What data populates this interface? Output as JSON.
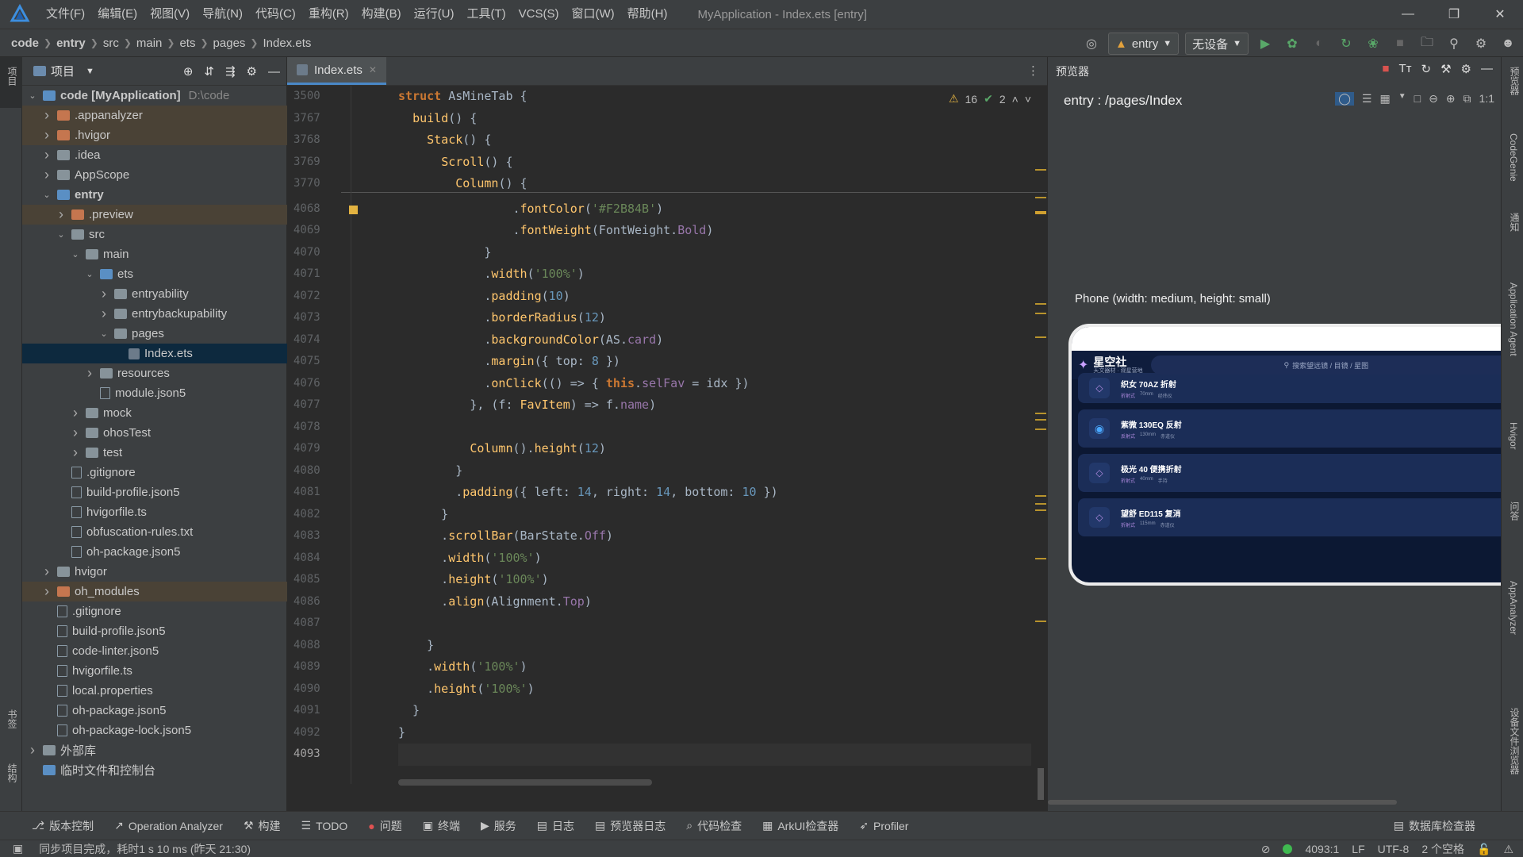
{
  "titlebar": {
    "menus": [
      "文件(F)",
      "编辑(E)",
      "视图(V)",
      "导航(N)",
      "代码(C)",
      "重构(R)",
      "构建(B)",
      "运行(U)",
      "工具(T)",
      "VCS(S)",
      "窗口(W)",
      "帮助(H)"
    ],
    "title": "MyApplication - Index.ets [entry]"
  },
  "navbar": {
    "breadcrumbs": [
      "code",
      "entry",
      "src",
      "main",
      "ets",
      "pages",
      "Index.ets"
    ],
    "run_config": "entry",
    "device": "无设备"
  },
  "project": {
    "title": "项目",
    "tree": [
      {
        "label": "code [MyApplication]",
        "extra": "D:\\code",
        "depth": 0,
        "arrow": "down",
        "kind": "dir-b",
        "bold": true
      },
      {
        "label": ".appanalyzer",
        "depth": 1,
        "arrow": "right",
        "kind": "dir-o",
        "hl": true
      },
      {
        "label": ".hvigor",
        "depth": 1,
        "arrow": "right",
        "kind": "dir-o",
        "hl": true
      },
      {
        "label": ".idea",
        "depth": 1,
        "arrow": "right",
        "kind": "dir"
      },
      {
        "label": "AppScope",
        "depth": 1,
        "arrow": "right",
        "kind": "dir"
      },
      {
        "label": "entry",
        "depth": 1,
        "arrow": "down",
        "kind": "dir-b",
        "bold": true
      },
      {
        "label": ".preview",
        "depth": 2,
        "arrow": "right",
        "kind": "dir-o",
        "hl": true
      },
      {
        "label": "src",
        "depth": 2,
        "arrow": "down",
        "kind": "dir"
      },
      {
        "label": "main",
        "depth": 3,
        "arrow": "down",
        "kind": "dir"
      },
      {
        "label": "ets",
        "depth": 4,
        "arrow": "down",
        "kind": "dir-b"
      },
      {
        "label": "entryability",
        "depth": 5,
        "arrow": "right",
        "kind": "dir"
      },
      {
        "label": "entrybackupability",
        "depth": 5,
        "arrow": "right",
        "kind": "dir"
      },
      {
        "label": "pages",
        "depth": 5,
        "arrow": "down",
        "kind": "dir"
      },
      {
        "label": "Index.ets",
        "depth": 6,
        "arrow": "",
        "kind": "ets",
        "sel": true
      },
      {
        "label": "resources",
        "depth": 4,
        "arrow": "right",
        "kind": "dir"
      },
      {
        "label": "module.json5",
        "depth": 4,
        "arrow": "",
        "kind": "file"
      },
      {
        "label": "mock",
        "depth": 3,
        "arrow": "right",
        "kind": "dir"
      },
      {
        "label": "ohosTest",
        "depth": 3,
        "arrow": "right",
        "kind": "dir"
      },
      {
        "label": "test",
        "depth": 3,
        "arrow": "right",
        "kind": "dir"
      },
      {
        "label": ".gitignore",
        "depth": 2,
        "arrow": "",
        "kind": "file"
      },
      {
        "label": "build-profile.json5",
        "depth": 2,
        "arrow": "",
        "kind": "file"
      },
      {
        "label": "hvigorfile.ts",
        "depth": 2,
        "arrow": "",
        "kind": "file"
      },
      {
        "label": "obfuscation-rules.txt",
        "depth": 2,
        "arrow": "",
        "kind": "file"
      },
      {
        "label": "oh-package.json5",
        "depth": 2,
        "arrow": "",
        "kind": "file"
      },
      {
        "label": "hvigor",
        "depth": 1,
        "arrow": "right",
        "kind": "dir"
      },
      {
        "label": "oh_modules",
        "depth": 1,
        "arrow": "right",
        "kind": "dir-o",
        "hl": true
      },
      {
        "label": ".gitignore",
        "depth": 1,
        "arrow": "",
        "kind": "file"
      },
      {
        "label": "build-profile.json5",
        "depth": 1,
        "arrow": "",
        "kind": "file"
      },
      {
        "label": "code-linter.json5",
        "depth": 1,
        "arrow": "",
        "kind": "file"
      },
      {
        "label": "hvigorfile.ts",
        "depth": 1,
        "arrow": "",
        "kind": "file"
      },
      {
        "label": "local.properties",
        "depth": 1,
        "arrow": "",
        "kind": "file"
      },
      {
        "label": "oh-package.json5",
        "depth": 1,
        "arrow": "",
        "kind": "file"
      },
      {
        "label": "oh-package-lock.json5",
        "depth": 1,
        "arrow": "",
        "kind": "file"
      },
      {
        "label": "外部库",
        "depth": 0,
        "arrow": "right",
        "kind": "lib"
      },
      {
        "label": "临时文件和控制台",
        "depth": 0,
        "arrow": "",
        "kind": "tmp"
      }
    ]
  },
  "editor": {
    "tab": "Index.ets",
    "warnings": "16",
    "checks": "2",
    "lines": [
      {
        "n": "3500",
        "html": "<span class='kw'>struct</span> <span class='cls'>AsMineTab</span> {"
      },
      {
        "n": "3767",
        "html": "  <span class='fn'>build</span>() {"
      },
      {
        "n": "3768",
        "html": "    <span class='fn'>Stack</span>() {"
      },
      {
        "n": "3769",
        "html": "      <span class='fn'>Scroll</span>() {"
      },
      {
        "n": "3770",
        "html": "        <span class='fn'>Column</span>() {"
      },
      {
        "n": "4068",
        "html": "                .<span class='fn'>fontColor</span>(<span class='str'>'#F2B84B'</span>)"
      },
      {
        "n": "4069",
        "html": "                .<span class='fn'>fontWeight</span>(FontWeight.<span class='prop'>Bold</span>)"
      },
      {
        "n": "4070",
        "html": "            }"
      },
      {
        "n": "4071",
        "html": "            .<span class='fn'>width</span>(<span class='str'>'100%'</span>)"
      },
      {
        "n": "4072",
        "html": "            .<span class='fn'>padding</span>(<span class='num'>10</span>)"
      },
      {
        "n": "4073",
        "html": "            .<span class='fn'>borderRadius</span>(<span class='num'>12</span>)"
      },
      {
        "n": "4074",
        "html": "            .<span class='fn'>backgroundColor</span>(AS.<span class='prop'>card</span>)"
      },
      {
        "n": "4075",
        "html": "            .<span class='fn'>margin</span>({ top: <span class='num'>8</span> })"
      },
      {
        "n": "4076",
        "html": "            .<span class='fn'>onClick</span>(() => { <span class='kw'>this</span>.<span class='prop'>selFav</span> = idx })"
      },
      {
        "n": "4077",
        "html": "          }, (f: <span class='ty'>FavItem</span>) => f.<span class='prop'>name</span>)"
      },
      {
        "n": "4078",
        "html": ""
      },
      {
        "n": "4079",
        "html": "          <span class='fn'>Column</span>().<span class='fn'>height</span>(<span class='num'>12</span>)"
      },
      {
        "n": "4080",
        "html": "        }"
      },
      {
        "n": "4081",
        "html": "        .<span class='fn'>padding</span>({ left: <span class='num'>14</span>, right: <span class='num'>14</span>, bottom: <span class='num'>10</span> })"
      },
      {
        "n": "4082",
        "html": "      }"
      },
      {
        "n": "4083",
        "html": "      .<span class='fn'>scrollBar</span>(BarState.<span class='prop'>Off</span>)"
      },
      {
        "n": "4084",
        "html": "      .<span class='fn'>width</span>(<span class='str'>'100%'</span>)"
      },
      {
        "n": "4085",
        "html": "      .<span class='fn'>height</span>(<span class='str'>'100%'</span>)"
      },
      {
        "n": "4086",
        "html": "      .<span class='fn'>align</span>(Alignment.<span class='prop'>Top</span>)"
      },
      {
        "n": "4087",
        "html": ""
      },
      {
        "n": "4088",
        "html": "    }"
      },
      {
        "n": "4089",
        "html": "    .<span class='fn'>width</span>(<span class='str'>'100%'</span>)"
      },
      {
        "n": "4090",
        "html": "    .<span class='fn'>height</span>(<span class='str'>'100%'</span>)"
      },
      {
        "n": "4091",
        "html": "  }"
      },
      {
        "n": "4092",
        "html": "}"
      },
      {
        "n": "4093",
        "html": ""
      }
    ]
  },
  "preview": {
    "title": "预览器",
    "route": "entry : /pages/Index",
    "device_label": "Phone (width: medium, height: small)",
    "app": {
      "name": "星空社",
      "tagline": "天文器材 · 观星营地",
      "search": "搜索望远镜 / 目镜 / 星图",
      "cards": [
        {
          "title": "织女 70AZ 折射",
          "tags": [
            "折射式",
            "70mm",
            "经纬仪"
          ],
          "selected": false
        },
        {
          "title": "紫微 130EQ 反射",
          "tags": [
            "反射式",
            "130mm",
            "赤道仪"
          ],
          "selected": true
        },
        {
          "title": "极光 40 便携折射",
          "tags": [
            "折射式",
            "40mm",
            "手持"
          ],
          "selected": false
        },
        {
          "title": "望舒 ED115 复消",
          "tags": [
            "折射式",
            "115mm",
            "赤道仪"
          ],
          "selected": false
        }
      ]
    }
  },
  "left_strip": {
    "top": "项目",
    "bottom1": "书签",
    "bottom2": "结构"
  },
  "right_strip": [
    "预览器",
    "CodeGenie",
    "通知",
    "Application Agent",
    "Hvigor",
    "问答",
    "AppAnalyzer",
    "设备文件浏览器"
  ],
  "toolwindows": [
    "版本控制",
    "Operation Analyzer",
    "构建",
    "TODO",
    "问题",
    "终端",
    "服务",
    "日志",
    "预览器日志",
    "代码检查",
    "ArkUI检查器",
    "Profiler",
    "数据库检查器"
  ],
  "status": {
    "message": "同步项目完成，耗时1 s 10 ms (昨天 21:30)",
    "position": "4093:1",
    "line_sep": "LF",
    "encoding": "UTF-8",
    "indent": "2 个空格"
  },
  "colors": {
    "accent": "#4a88c7",
    "selected_row": "#0d293e",
    "string": "#6a8759",
    "keyword": "#cc7832",
    "function": "#ffc66d"
  }
}
